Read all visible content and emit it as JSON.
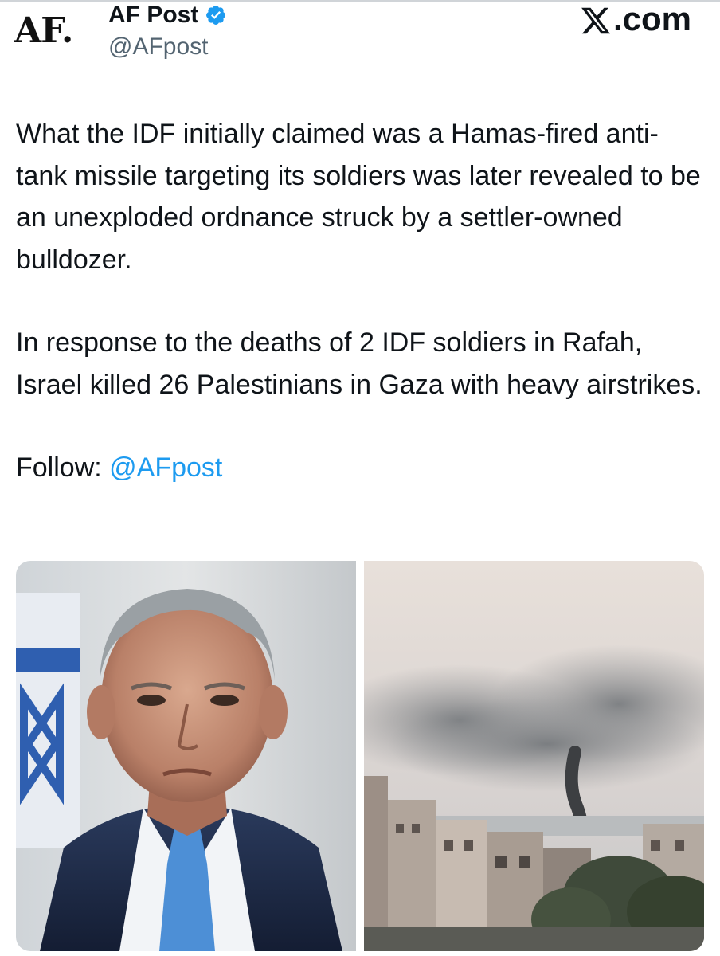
{
  "header": {
    "avatar_text": "AF.",
    "display_name": "AF Post",
    "handle": "@AFpost",
    "site_label": ".com",
    "verified_color": "#1d9bf0"
  },
  "tweet": {
    "paragraph_1": "What the IDF initially claimed was a Hamas-fired anti-tank missile targeting its soldiers was later revealed to be an unexploded ordnance struck by a settler-owned bulldozer.",
    "paragraph_2": "In response to the deaths of 2 IDF soldiers in Rafah, Israel killed 26 Palestinians in Gaza with heavy airstrikes.",
    "follow_label": "Follow: ",
    "follow_mention": "@AFpost"
  },
  "media": {
    "left_icon": "portrait-photo",
    "right_icon": "airstrike-smoke-photo"
  },
  "colors": {
    "link": "#1d9bf0",
    "text": "#0f1419",
    "secondary": "#536471"
  }
}
